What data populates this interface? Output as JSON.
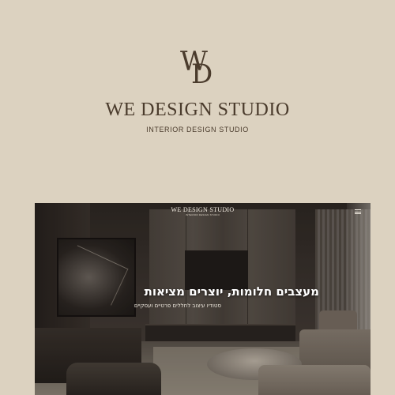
{
  "brand": {
    "monogram_w": "W",
    "monogram_d": "D",
    "name": "WE DESIGN STUDIO",
    "tagline": "INTERIOR DESIGN STUDIO"
  },
  "site": {
    "logo": "WE DESIGN STUDIO",
    "logo_tagline": "INTERIOR DESIGN STUDIO",
    "menu_icon": "hamburger-menu-icon",
    "hero_title": "מעצבים חלומות, יוצרים מציאות",
    "hero_subtitle": "סטודיו עיצוב לחללים פרטיים ועסקיים"
  },
  "colors": {
    "background": "#dcd2c0",
    "brand_text": "#4a3b2c"
  }
}
